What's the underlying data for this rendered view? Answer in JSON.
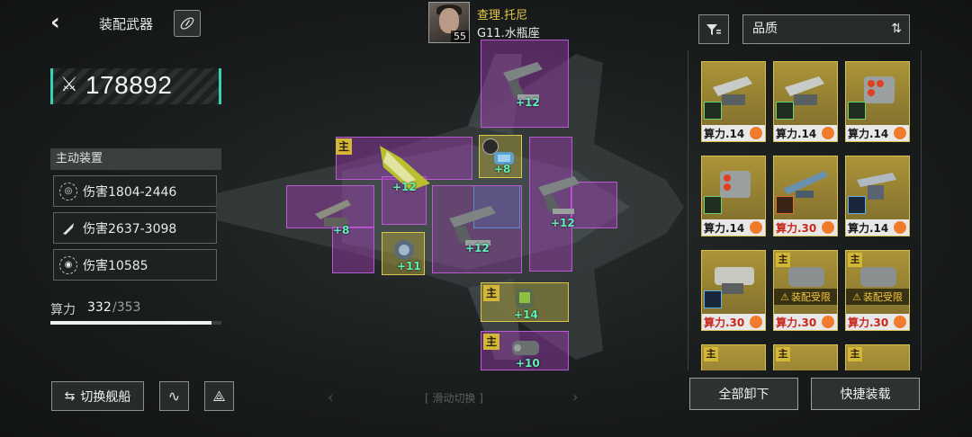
{
  "header": {
    "title": "装配武器"
  },
  "power": {
    "value": "178892"
  },
  "active_device": {
    "title": "主动装置",
    "stats": [
      {
        "icon": "target-icon",
        "text": "伤害1804-2446"
      },
      {
        "icon": "missile-icon",
        "text": "伤害2637-3098"
      },
      {
        "icon": "radial-icon",
        "text": "伤害10585"
      }
    ]
  },
  "compute": {
    "label": "算力",
    "current": "332",
    "max": "/353",
    "fill_fraction": 0.94
  },
  "buttons": {
    "switch_ship": "切换舰船",
    "unequip_all": "全部卸下",
    "quick_equip": "快捷装载"
  },
  "captain": {
    "name": "查理.托尼",
    "sub": "G11.水瓶座",
    "level": "55"
  },
  "swipe_hint": "[ 滑动切换 ]",
  "sort": {
    "label": "品质"
  },
  "slots": [
    {
      "label": "+12"
    },
    {
      "label": "+12"
    },
    {
      "label": "+8"
    },
    {
      "label": "+12"
    },
    {
      "label": "+8"
    },
    {
      "label": "+11"
    },
    {
      "label": "+12"
    },
    {
      "label": "+14"
    },
    {
      "label": "+10"
    }
  ],
  "main_tag": "主",
  "inventory": [
    {
      "cap": "算力.14",
      "limit": ""
    },
    {
      "cap": "算力.14",
      "limit": ""
    },
    {
      "cap": "算力.14",
      "limit": ""
    },
    {
      "cap": "算力.14",
      "limit": ""
    },
    {
      "cap": "算力.30",
      "limit": ""
    },
    {
      "cap": "算力.14",
      "limit": ""
    },
    {
      "cap": "算力.30",
      "limit": ""
    },
    {
      "cap": "算力.30",
      "limit": "装配受限"
    },
    {
      "cap": "算力.30",
      "limit": "装配受限"
    }
  ],
  "colors": {
    "accent": "#39d0b4",
    "slot_purple": "#b85ad0",
    "slot_gold": "#d8c84c",
    "card_gold": "#ac9438",
    "main_tag": "#d4b736"
  }
}
